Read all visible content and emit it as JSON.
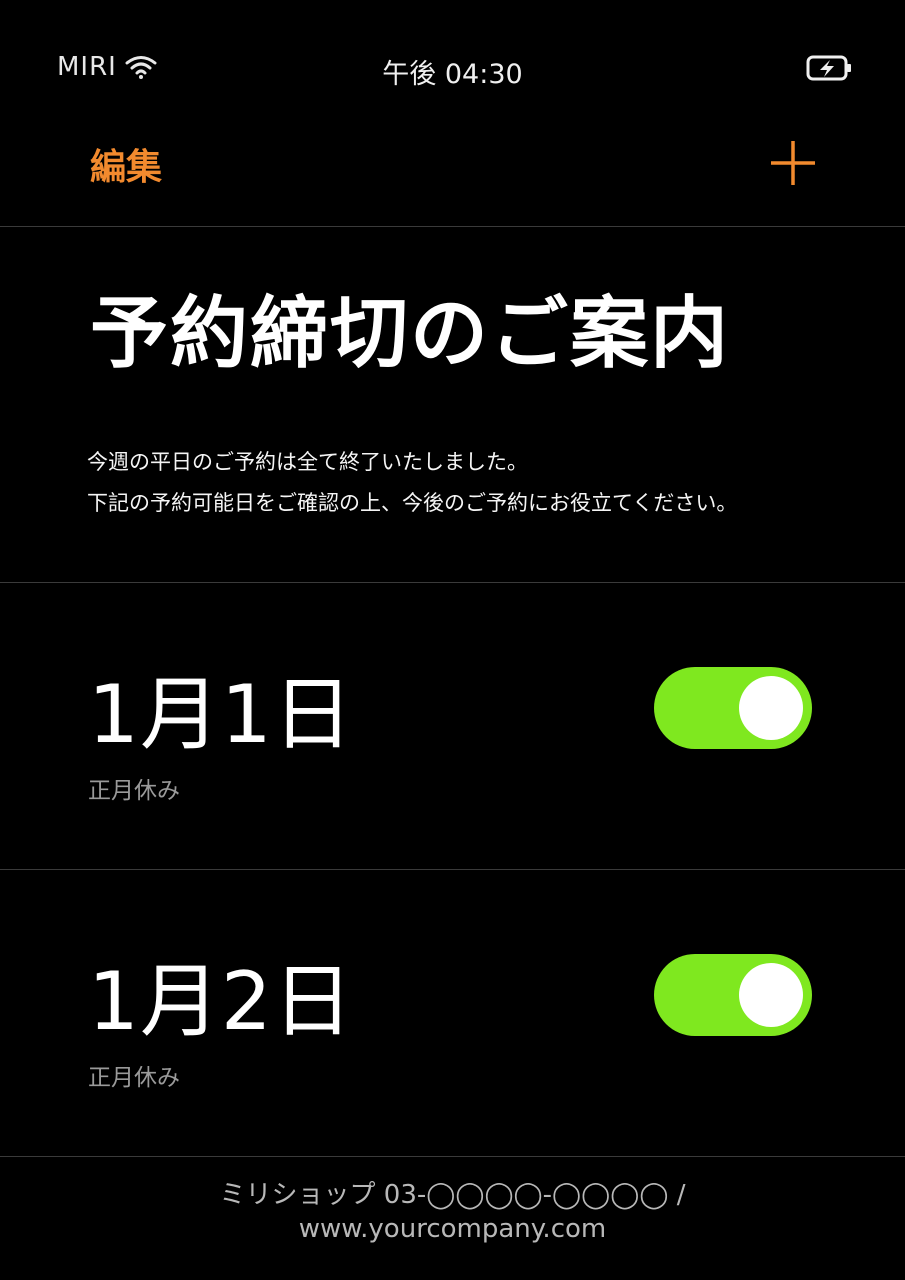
{
  "status_bar": {
    "carrier": "MIRI",
    "time": "午後 04:30",
    "wifi_icon": "wifi-icon",
    "battery_icon": "battery-charging-icon"
  },
  "nav": {
    "edit_label": "編集",
    "add_icon": "plus-icon",
    "accent_color": "#f28a2e"
  },
  "main": {
    "title": "予約締切のご案内",
    "description": [
      "今週の平日のご予約は全て終了いたしました。",
      "下記の予約可能日をご確認の上、今後のご予約にお役立てください。"
    ]
  },
  "dates": [
    {
      "label": "1月1日",
      "note": "正月休み",
      "enabled": true
    },
    {
      "label": "1月2日",
      "note": "正月休み",
      "enabled": true
    }
  ],
  "toggle_color": "#7fe81f",
  "footer": {
    "line1": "ミリショップ 03-◯◯◯◯-◯◯◯◯ /",
    "line2": "www.yourcompany.com"
  }
}
